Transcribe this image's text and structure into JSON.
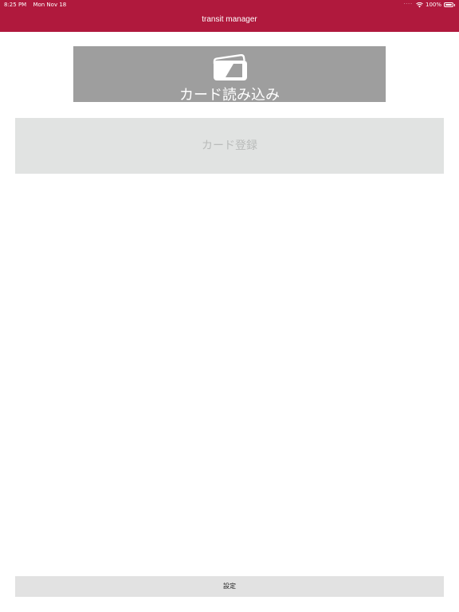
{
  "status_bar": {
    "time": "8:25 PM",
    "date": "Mon Nov 18",
    "battery": "100%",
    "icons": [
      "wifi-icon",
      "battery-icon"
    ]
  },
  "nav": {
    "title": "transit manager"
  },
  "read_card": {
    "label": "カード読み込み",
    "icon": "card-icon"
  },
  "register_card": {
    "label": "カード登録"
  },
  "settings": {
    "label": "設定"
  },
  "colors": {
    "nav_bar": "#b0193d",
    "read_button": "#9e9e9e",
    "register_button": "#e1e3e2",
    "register_text": "#b9bbba",
    "settings_button": "#e2e2e2"
  }
}
